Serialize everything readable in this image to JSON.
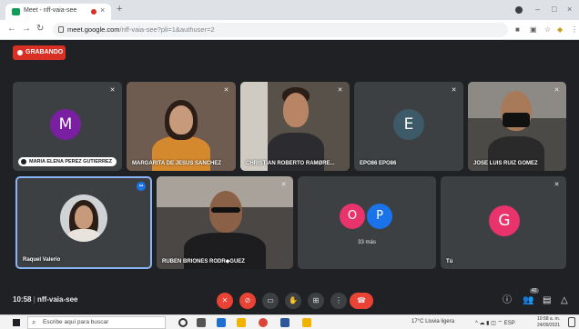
{
  "browser": {
    "tab_title": "Meet - nff-vaia-see",
    "new_tab": "+",
    "url_host": "meet.google.com",
    "url_path": "/nff-vaia-see?pli=1&authuser=2"
  },
  "meet": {
    "recording_label": "GRABANDO",
    "meeting_time": "10:58",
    "meeting_code": "nff-vaia-see",
    "participants": [
      {
        "name": "MARIA ELENA PEREZ GUTIERREZ",
        "initial": "M",
        "color": "#7b1fa2"
      },
      {
        "name": "MARGARITA DE JESUS SANCHEZ"
      },
      {
        "name": "CHRISTIAN ROBERTO RAMØRE..."
      },
      {
        "name": "EPO86 EPO86",
        "initial": "E",
        "color": "#3c5a68"
      },
      {
        "name": "JOSE LUIS RUIZ GOMEZ"
      },
      {
        "name": "Raquel Valerio"
      },
      {
        "name": "RUBEN BRIONES RODR◆GUEZ"
      },
      {
        "name": "33 más",
        "initials": [
          "O",
          "P"
        ],
        "colors": [
          "#e8336d",
          "#1a73e8"
        ]
      },
      {
        "name": "Tú",
        "initial": "G",
        "color": "#e8336d"
      }
    ],
    "participants_badge": "42"
  },
  "taskbar": {
    "search_placeholder": "Escribe aquí para buscar",
    "weather": "17°C  Lluvia ligera",
    "time": "10:58 a. m.",
    "date": "24/09/2021"
  }
}
